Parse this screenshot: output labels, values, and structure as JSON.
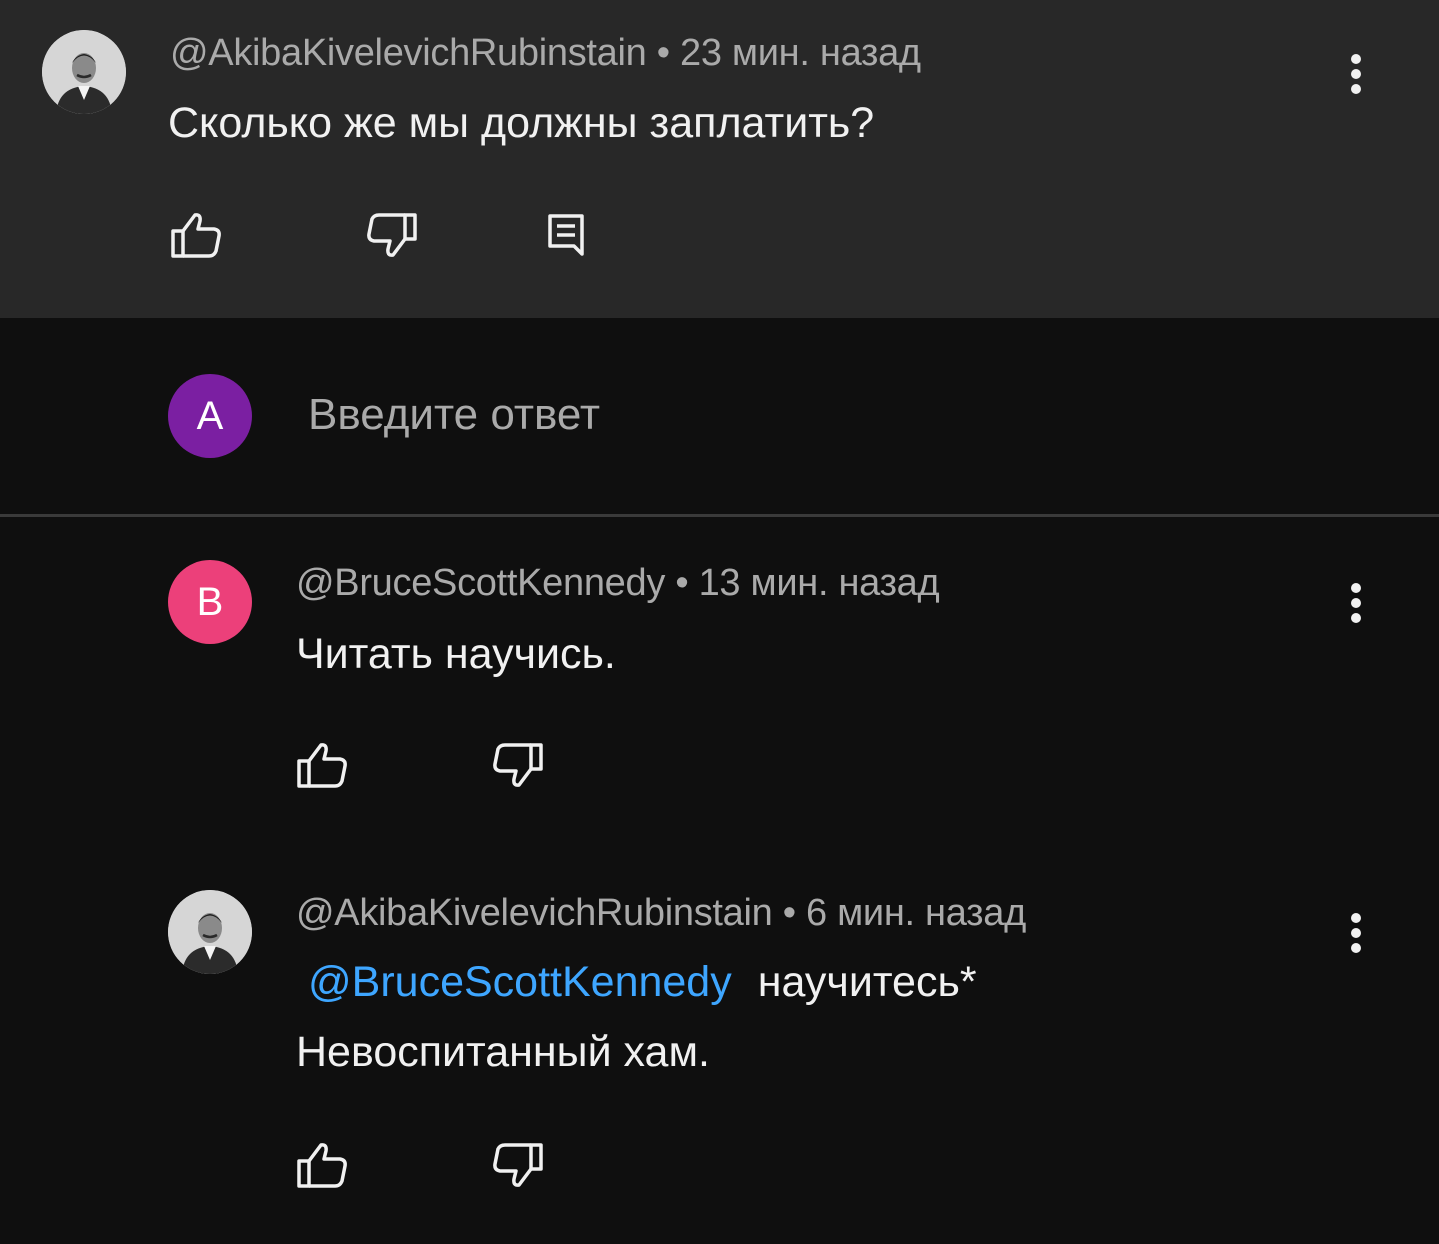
{
  "top_comment": {
    "author": "@AkibaKivelevichRubinstain",
    "separator": " • ",
    "time": "23 мин. назад",
    "text": "Сколько же мы должны заплатить?",
    "avatar_icon": "vintage-portrait-avatar"
  },
  "reply_box": {
    "avatar_letter": "A",
    "avatar_color": "#7b1fa2",
    "placeholder": "Введите ответ"
  },
  "replies": [
    {
      "author": "@BruceScottKennedy",
      "separator": " • ",
      "time": "13 мин. назад",
      "text": "Читать научись.",
      "avatar_letter": "B",
      "avatar_color": "#ec407a"
    },
    {
      "author": "@AkibaKivelevichRubinstain",
      "separator": " • ",
      "time": "6 мин. назад",
      "mention": "@BruceScottKennedy",
      "text_after_mention": "научитесь*",
      "text_line2": "Невоспитанный хам.",
      "avatar_icon": "vintage-portrait-avatar"
    }
  ],
  "colors": {
    "background": "#0f0f0f",
    "highlight_background": "#282828",
    "mention": "#3ea6ff",
    "meta_text": "#aaaaaa",
    "body_text": "#f1f1f1"
  },
  "icons": [
    "thumb-up-icon",
    "thumb-down-icon",
    "reply-icon",
    "more-vert-icon"
  ]
}
